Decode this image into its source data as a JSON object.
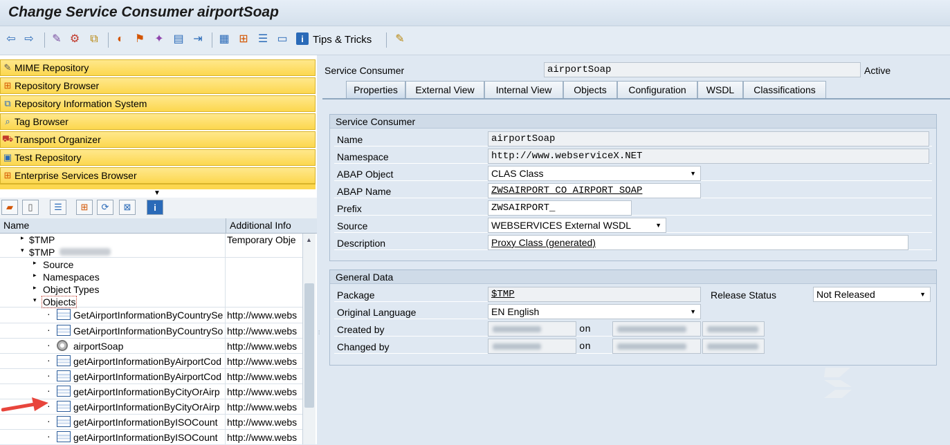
{
  "window": {
    "title": "Change Service Consumer airportSoap"
  },
  "toolbar": {
    "tips_label": "Tips & Tricks"
  },
  "nav": {
    "items": [
      {
        "label": "MIME Repository"
      },
      {
        "label": "Repository Browser"
      },
      {
        "label": "Repository Information System"
      },
      {
        "label": "Tag Browser"
      },
      {
        "label": "Transport Organizer"
      },
      {
        "label": "Test Repository"
      },
      {
        "label": "Enterprise Services Browser"
      }
    ]
  },
  "tree": {
    "headers": {
      "name": "Name",
      "info": "Additional Info"
    },
    "rows": [
      {
        "name": "$TMP",
        "info": "Temporary Obje"
      },
      {
        "name": "$TMP",
        "info": ""
      },
      {
        "name": "Source",
        "info": ""
      },
      {
        "name": "Namespaces",
        "info": ""
      },
      {
        "name": "Object Types",
        "info": ""
      },
      {
        "name": "Objects",
        "info": ""
      },
      {
        "name": "GetAirportInformationByCountrySe",
        "info": "http://www.webs"
      },
      {
        "name": "GetAirportInformationByCountrySo",
        "info": "http://www.webs"
      },
      {
        "name": "airportSoap",
        "info": "http://www.webs"
      },
      {
        "name": "getAirportInformationByAirportCod",
        "info": "http://www.webs"
      },
      {
        "name": "getAirportInformationByAirportCod",
        "info": "http://www.webs"
      },
      {
        "name": "getAirportInformationByCityOrAirp",
        "info": "http://www.webs"
      },
      {
        "name": "getAirportInformationByCityOrAirp",
        "info": "http://www.webs"
      },
      {
        "name": "getAirportInformationByISOCount",
        "info": "http://www.webs"
      },
      {
        "name": "getAirportInformationByISOCount",
        "info": "http://www.webs"
      }
    ]
  },
  "header": {
    "label": "Service Consumer",
    "value": "airportSoap",
    "status": "Active"
  },
  "tabs": [
    "Properties",
    "External View",
    "Internal View",
    "Objects",
    "Configuration",
    "WSDL",
    "Classifications"
  ],
  "service_consumer": {
    "title": "Service Consumer",
    "name_label": "Name",
    "name": "airportSoap",
    "namespace_label": "Namespace",
    "namespace": "http://www.webserviceX.NET",
    "abap_object_label": "ABAP Object",
    "abap_object": "CLAS Class",
    "abap_name_label": "ABAP Name",
    "abap_name": "ZWSAIRPORT_CO_AIRPORT_SOAP",
    "prefix_label": "Prefix",
    "prefix": "ZWSAIRPORT_",
    "source_label": "Source",
    "source": "WEBSERVICES External WSDL",
    "description_label": "Description",
    "description": "Proxy Class (generated)"
  },
  "general_data": {
    "title": "General Data",
    "package_label": "Package",
    "package": "$TMP",
    "release_label": "Release Status",
    "release": "Not Released",
    "language_label": "Original Language",
    "language": "EN English",
    "created_label": "Created by",
    "changed_label": "Changed by",
    "on_label": "on"
  }
}
